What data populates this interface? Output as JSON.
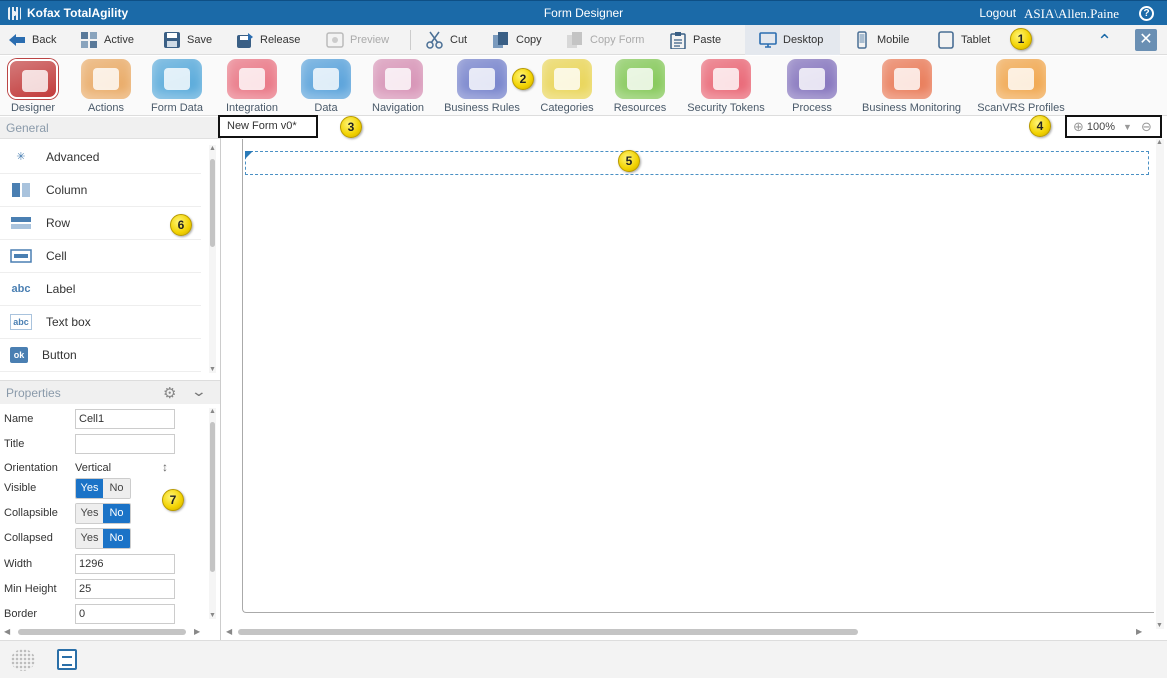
{
  "titlebar": {
    "brand": "Kofax TotalAgility",
    "title": "Form Designer",
    "logout": "Logout",
    "user": "ASIA\\Allen.Paine",
    "help": "?"
  },
  "toolbar": {
    "back": "Back",
    "active": "Active",
    "save": "Save",
    "release": "Release",
    "preview": "Preview",
    "cut": "Cut",
    "copy": "Copy",
    "copy_form": "Copy Form",
    "paste": "Paste",
    "desktop": "Desktop",
    "mobile": "Mobile",
    "tablet": "Tablet"
  },
  "ribbon": {
    "items": [
      {
        "label": "Designer",
        "color": "#c23b3b"
      },
      {
        "label": "Actions",
        "color": "#e8a45a"
      },
      {
        "label": "Form Data",
        "color": "#4aa3d8"
      },
      {
        "label": "Integration",
        "color": "#e86a7a"
      },
      {
        "label": "Data",
        "color": "#4a9ad8"
      },
      {
        "label": "Navigation",
        "color": "#d48ab0"
      },
      {
        "label": "Business Rules",
        "color": "#6a78c8"
      },
      {
        "label": "Categories",
        "color": "#e8d24a"
      },
      {
        "label": "Resources",
        "color": "#7ac44a"
      },
      {
        "label": "Security Tokens",
        "color": "#e85a6a"
      },
      {
        "label": "Process",
        "color": "#7a68b8"
      },
      {
        "label": "Business Monitoring",
        "color": "#e8704a"
      },
      {
        "label": "ScanVRS Profiles",
        "color": "#f0a040"
      }
    ]
  },
  "general": {
    "heading": "General",
    "items": [
      {
        "label": "Advanced",
        "icon": "magic-wand-icon"
      },
      {
        "label": "Column",
        "icon": "column-icon"
      },
      {
        "label": "Row",
        "icon": "row-icon"
      },
      {
        "label": "Cell",
        "icon": "cell-icon"
      },
      {
        "label": "Label",
        "icon": "label-icon",
        "glyph": "abc"
      },
      {
        "label": "Text box",
        "icon": "textbox-icon",
        "glyph": "abc"
      },
      {
        "label": "Button",
        "icon": "button-icon",
        "glyph": "ok"
      }
    ]
  },
  "properties": {
    "heading": "Properties",
    "name_label": "Name",
    "name_value": "Cell1",
    "title_label": "Title",
    "title_value": "",
    "orientation_label": "Orientation",
    "orientation_value": "Vertical",
    "visible_label": "Visible",
    "collapsible_label": "Collapsible",
    "collapsed_label": "Collapsed",
    "yes": "Yes",
    "no": "No",
    "width_label": "Width",
    "width_value": "1296",
    "min_height_label": "Min Height",
    "min_height_value": "25",
    "border_label": "Border",
    "border_value": "0"
  },
  "canvas": {
    "tab": "New Form  v0*",
    "zoom": "100%"
  },
  "callouts": [
    "1",
    "2",
    "3",
    "4",
    "5",
    "6",
    "7"
  ],
  "colors": {
    "titlebar": "#1b6aa8",
    "accent": "#1b73c7"
  }
}
